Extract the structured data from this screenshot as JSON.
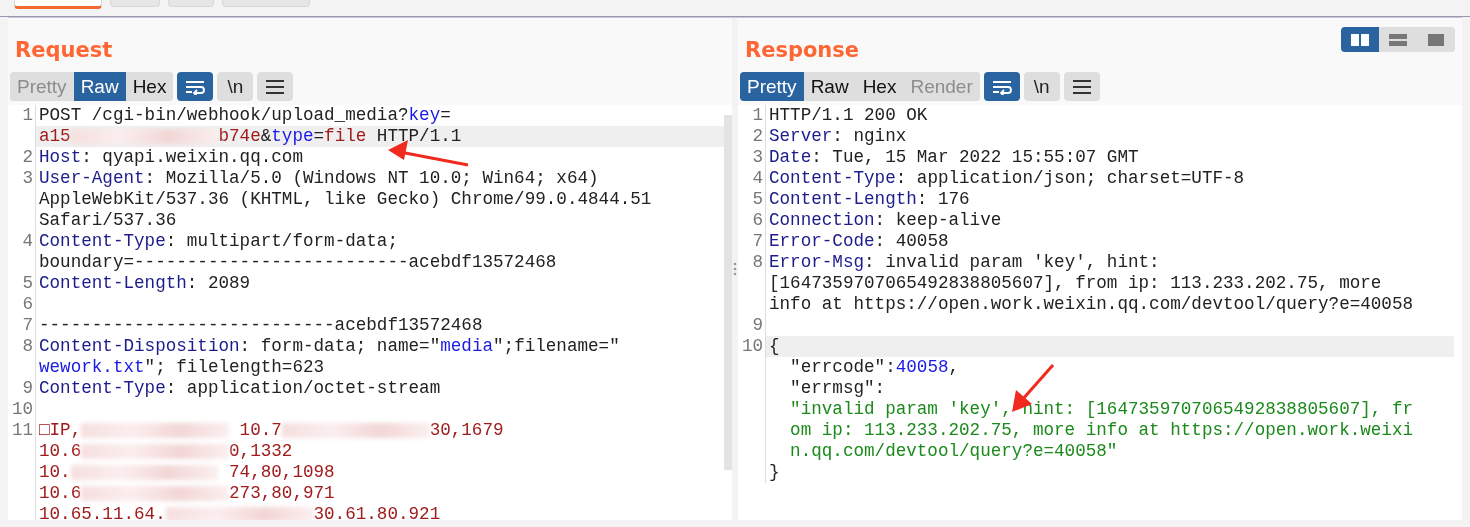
{
  "top_tabs": [
    {
      "selected": true
    },
    {
      "selected": false
    },
    {
      "selected": false
    },
    {
      "selected": false
    }
  ],
  "request": {
    "title": "Request",
    "view_tabs": [
      {
        "label": "Pretty",
        "selected": false,
        "disabled": true
      },
      {
        "label": "Raw",
        "selected": true,
        "disabled": false
      },
      {
        "label": "Hex",
        "selected": false,
        "disabled": false
      }
    ],
    "wrap_on": true,
    "newline_label": "\\n",
    "lines": [
      {
        "number": "1",
        "rows": [
          {
            "highlighted": false,
            "segments": [
              {
                "kind": "plain",
                "text": "POST /cgi-bin/webhook/upload_media?"
              },
              {
                "kind": "param",
                "text": "key"
              },
              {
                "kind": "plain",
                "text": "="
              }
            ]
          },
          {
            "highlighted": true,
            "segments": [
              {
                "kind": "value",
                "text": "a15"
              },
              {
                "kind": "redacted"
              },
              {
                "kind": "value",
                "text": "b74e"
              },
              {
                "kind": "plain",
                "text": "&"
              },
              {
                "kind": "param",
                "text": "type"
              },
              {
                "kind": "plain",
                "text": "="
              },
              {
                "kind": "value",
                "text": "file"
              },
              {
                "kind": "plain",
                "text": " HTTP/1.1"
              }
            ]
          }
        ]
      },
      {
        "number": "2",
        "rows": [
          {
            "highlighted": false,
            "segments": [
              {
                "kind": "name",
                "text": "Host"
              },
              {
                "kind": "plain",
                "text": ": qyapi.weixin.qq.com"
              }
            ]
          }
        ]
      },
      {
        "number": "3",
        "rows": [
          {
            "highlighted": false,
            "segments": [
              {
                "kind": "name",
                "text": "User-Agent"
              },
              {
                "kind": "plain",
                "text": ": Mozilla/5.0 (Windows NT 10.0; Win64; x64)"
              }
            ]
          },
          {
            "highlighted": false,
            "segments": [
              {
                "kind": "plain",
                "text": "AppleWebKit/537.36 (KHTML, like Gecko) Chrome/99.0.4844.51"
              }
            ]
          },
          {
            "highlighted": false,
            "segments": [
              {
                "kind": "plain",
                "text": "Safari/537.36"
              }
            ]
          }
        ]
      },
      {
        "number": "4",
        "rows": [
          {
            "highlighted": false,
            "segments": [
              {
                "kind": "name",
                "text": "Content-Type"
              },
              {
                "kind": "plain",
                "text": ": multipart/form-data;"
              }
            ]
          },
          {
            "highlighted": false,
            "segments": [
              {
                "kind": "plain",
                "text": "boundary=--------------------------acebdf13572468"
              }
            ]
          }
        ]
      },
      {
        "number": "5",
        "rows": [
          {
            "highlighted": false,
            "segments": [
              {
                "kind": "name",
                "text": "Content-Length"
              },
              {
                "kind": "plain",
                "text": ": 2089"
              }
            ]
          }
        ]
      },
      {
        "number": "6",
        "rows": [
          {
            "highlighted": false,
            "segments": []
          }
        ]
      },
      {
        "number": "7",
        "rows": [
          {
            "highlighted": false,
            "segments": [
              {
                "kind": "plain",
                "text": "----------------------------acebdf13572468"
              }
            ]
          }
        ]
      },
      {
        "number": "8",
        "rows": [
          {
            "highlighted": false,
            "segments": [
              {
                "kind": "name",
                "text": "Content-Disposition"
              },
              {
                "kind": "plain",
                "text": ": form-data; name=\""
              },
              {
                "kind": "param",
                "text": "media"
              },
              {
                "kind": "plain",
                "text": "\";filename=\""
              }
            ]
          },
          {
            "highlighted": false,
            "segments": [
              {
                "kind": "param",
                "text": "wework.txt"
              },
              {
                "kind": "plain",
                "text": "\"; filelength=623"
              }
            ]
          }
        ]
      },
      {
        "number": "9",
        "rows": [
          {
            "highlighted": false,
            "segments": [
              {
                "kind": "name",
                "text": "Content-Type"
              },
              {
                "kind": "plain",
                "text": ": application/octet-stream"
              }
            ]
          }
        ]
      },
      {
        "number": "10",
        "rows": [
          {
            "highlighted": false,
            "segments": []
          }
        ]
      },
      {
        "number": "11",
        "rows": [
          {
            "highlighted": false,
            "segments": [
              {
                "kind": "value",
                "text": "□IP,"
              },
              {
                "kind": "redacted"
              },
              {
                "kind": "value",
                "text": " 10.7"
              },
              {
                "kind": "redacted"
              },
              {
                "kind": "value",
                "text": "30,1679"
              }
            ]
          },
          {
            "highlighted": false,
            "segments": [
              {
                "kind": "value",
                "text": "10.6"
              },
              {
                "kind": "redacted"
              },
              {
                "kind": "value",
                "text": "0,1332"
              }
            ]
          },
          {
            "highlighted": false,
            "segments": [
              {
                "kind": "value",
                "text": "10."
              },
              {
                "kind": "redacted"
              },
              {
                "kind": "value",
                "text": " 74,80,1098"
              }
            ]
          },
          {
            "highlighted": false,
            "segments": [
              {
                "kind": "value",
                "text": "10.6"
              },
              {
                "kind": "redacted"
              },
              {
                "kind": "value",
                "text": "273,80,971"
              }
            ]
          },
          {
            "highlighted": false,
            "segments": [
              {
                "kind": "value",
                "text": "10.65.11.64."
              },
              {
                "kind": "redacted"
              },
              {
                "kind": "value",
                "text": "30.61.80.921"
              }
            ]
          }
        ]
      }
    ]
  },
  "response": {
    "title": "Response",
    "layout_buttons": [
      {
        "selected": true
      },
      {
        "selected": false
      },
      {
        "selected": false
      }
    ],
    "view_tabs": [
      {
        "label": "Pretty",
        "selected": true,
        "disabled": false
      },
      {
        "label": "Raw",
        "selected": false,
        "disabled": false
      },
      {
        "label": "Hex",
        "selected": false,
        "disabled": false
      },
      {
        "label": "Render",
        "selected": false,
        "disabled": true
      }
    ],
    "wrap_on": true,
    "newline_label": "\\n",
    "lines": [
      {
        "number": "1",
        "rows": [
          {
            "highlighted": false,
            "segments": [
              {
                "kind": "plain",
                "text": "HTTP/1.1 200 OK"
              }
            ]
          }
        ]
      },
      {
        "number": "2",
        "rows": [
          {
            "highlighted": false,
            "segments": [
              {
                "kind": "name",
                "text": "Server"
              },
              {
                "kind": "plain",
                "text": ": nginx"
              }
            ]
          }
        ]
      },
      {
        "number": "3",
        "rows": [
          {
            "highlighted": false,
            "segments": [
              {
                "kind": "name",
                "text": "Date"
              },
              {
                "kind": "plain",
                "text": ": Tue, 15 Mar 2022 15:55:07 GMT"
              }
            ]
          }
        ]
      },
      {
        "number": "4",
        "rows": [
          {
            "highlighted": false,
            "segments": [
              {
                "kind": "name",
                "text": "Content-Type"
              },
              {
                "kind": "plain",
                "text": ": application/json; charset=UTF-8"
              }
            ]
          }
        ]
      },
      {
        "number": "5",
        "rows": [
          {
            "highlighted": false,
            "segments": [
              {
                "kind": "name",
                "text": "Content-Length"
              },
              {
                "kind": "plain",
                "text": ": 176"
              }
            ]
          }
        ]
      },
      {
        "number": "6",
        "rows": [
          {
            "highlighted": false,
            "segments": [
              {
                "kind": "name",
                "text": "Connection"
              },
              {
                "kind": "plain",
                "text": ": keep-alive"
              }
            ]
          }
        ]
      },
      {
        "number": "7",
        "rows": [
          {
            "highlighted": false,
            "segments": [
              {
                "kind": "name",
                "text": "Error-Code"
              },
              {
                "kind": "plain",
                "text": ": 40058"
              }
            ]
          }
        ]
      },
      {
        "number": "8",
        "rows": [
          {
            "highlighted": false,
            "segments": [
              {
                "kind": "name",
                "text": "Error-Msg"
              },
              {
                "kind": "plain",
                "text": ": invalid param 'key', hint:"
              }
            ]
          },
          {
            "highlighted": false,
            "segments": [
              {
                "kind": "plain",
                "text": "[1647359707065492838805607], from ip: 113.233.202.75, more"
              }
            ]
          },
          {
            "highlighted": false,
            "segments": [
              {
                "kind": "plain",
                "text": "info at https://open.work.weixin.qq.com/devtool/query?e=40058"
              }
            ]
          }
        ]
      },
      {
        "number": "9",
        "rows": [
          {
            "highlighted": false,
            "segments": []
          }
        ]
      },
      {
        "number": "10",
        "rows": [
          {
            "highlighted": true,
            "segments": [
              {
                "kind": "plain",
                "text": "{"
              }
            ]
          },
          {
            "highlighted": false,
            "segments": [
              {
                "kind": "plain",
                "text": "  \"errcode\":"
              },
              {
                "kind": "param",
                "text": "40058"
              },
              {
                "kind": "plain",
                "text": ","
              }
            ]
          },
          {
            "highlighted": false,
            "segments": [
              {
                "kind": "plain",
                "text": "  \"errmsg\":"
              }
            ]
          },
          {
            "highlighted": false,
            "segments": [
              {
                "kind": "string",
                "text": "  \"invalid param 'key', hint: [1647359707065492838805607], fr"
              }
            ]
          },
          {
            "highlighted": false,
            "segments": [
              {
                "kind": "string",
                "text": "  om ip: 113.233.202.75, more info at https://open.work.weixi"
              }
            ]
          },
          {
            "highlighted": false,
            "segments": [
              {
                "kind": "string",
                "text": "  n.qq.com/devtool/query?e=40058\""
              }
            ]
          },
          {
            "highlighted": false,
            "segments": [
              {
                "kind": "plain",
                "text": "}"
              }
            ]
          }
        ]
      }
    ]
  }
}
